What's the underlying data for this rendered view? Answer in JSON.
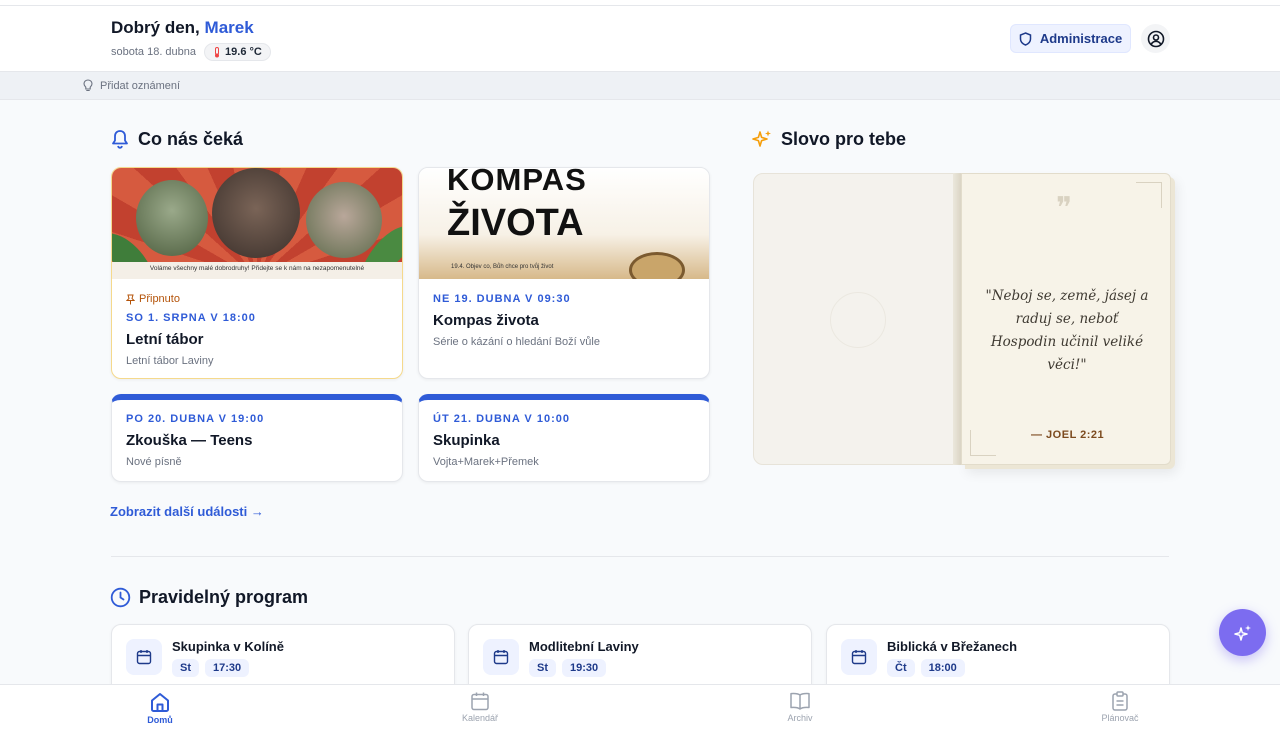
{
  "header": {
    "greeting_prefix": "Dobrý den,",
    "user_name": "Marek",
    "date": "sobota 18. dubna",
    "temperature": "19.6 °C",
    "admin_label": "Administrace"
  },
  "announce": {
    "label": "Přidat oznámení"
  },
  "events_section": {
    "title": "Co nás čeká",
    "cards": [
      {
        "pinned_label": "Připnuto",
        "date": "SO 1. SRPNA V 18:00",
        "title": "Letní tábor",
        "subtitle": "Letní tábor Laviny",
        "image_caption": "Voláme všechny malé dobrodruhy! Přidejte se k nám na nezapomenutelné"
      },
      {
        "date": "NE 19. DUBNA V 09:30",
        "title": "Kompas života",
        "subtitle": "Série o kázání o hledání Boží vůle",
        "image_title_1": "KOMPAS",
        "image_title_2": "ŽIVOTA",
        "image_caption": "19.4. Objev co, Bůh chce pro tvůj život"
      },
      {
        "date": "PO 20. DUBNA V 19:00",
        "title": "Zkouška — Teens",
        "subtitle": "Nové písně"
      },
      {
        "date": "ÚT 21. DUBNA V 10:00",
        "title": "Skupinka",
        "subtitle": "Vojta+Marek+Přemek"
      }
    ],
    "more_link": "Zobrazit další události →"
  },
  "word_section": {
    "title": "Slovo pro tebe",
    "quote": "\"Neboj se, země, jásej a raduj se, neboť Hospodin učinil veliké věci!\"",
    "reference": "— JOEL 2:21"
  },
  "program_section": {
    "title": "Pravidelný program",
    "items": [
      {
        "name": "Skupinka v Kolíně",
        "day": "St",
        "time": "17:30"
      },
      {
        "name": "Modlitební Laviny",
        "day": "St",
        "time": "19:30"
      },
      {
        "name": "Biblická v Břežanech",
        "day": "Čt",
        "time": "18:00"
      }
    ]
  },
  "nav": {
    "items": [
      {
        "label": "Domů",
        "icon": "home-icon"
      },
      {
        "label": "Kalendář",
        "icon": "calendar-icon"
      },
      {
        "label": "Archiv",
        "icon": "book-icon"
      },
      {
        "label": "Plánovač",
        "icon": "clipboard-icon"
      }
    ]
  },
  "colors": {
    "accent": "#2f5bd7",
    "fab": "#7c6cf0",
    "pinned": "#f5d98c"
  }
}
